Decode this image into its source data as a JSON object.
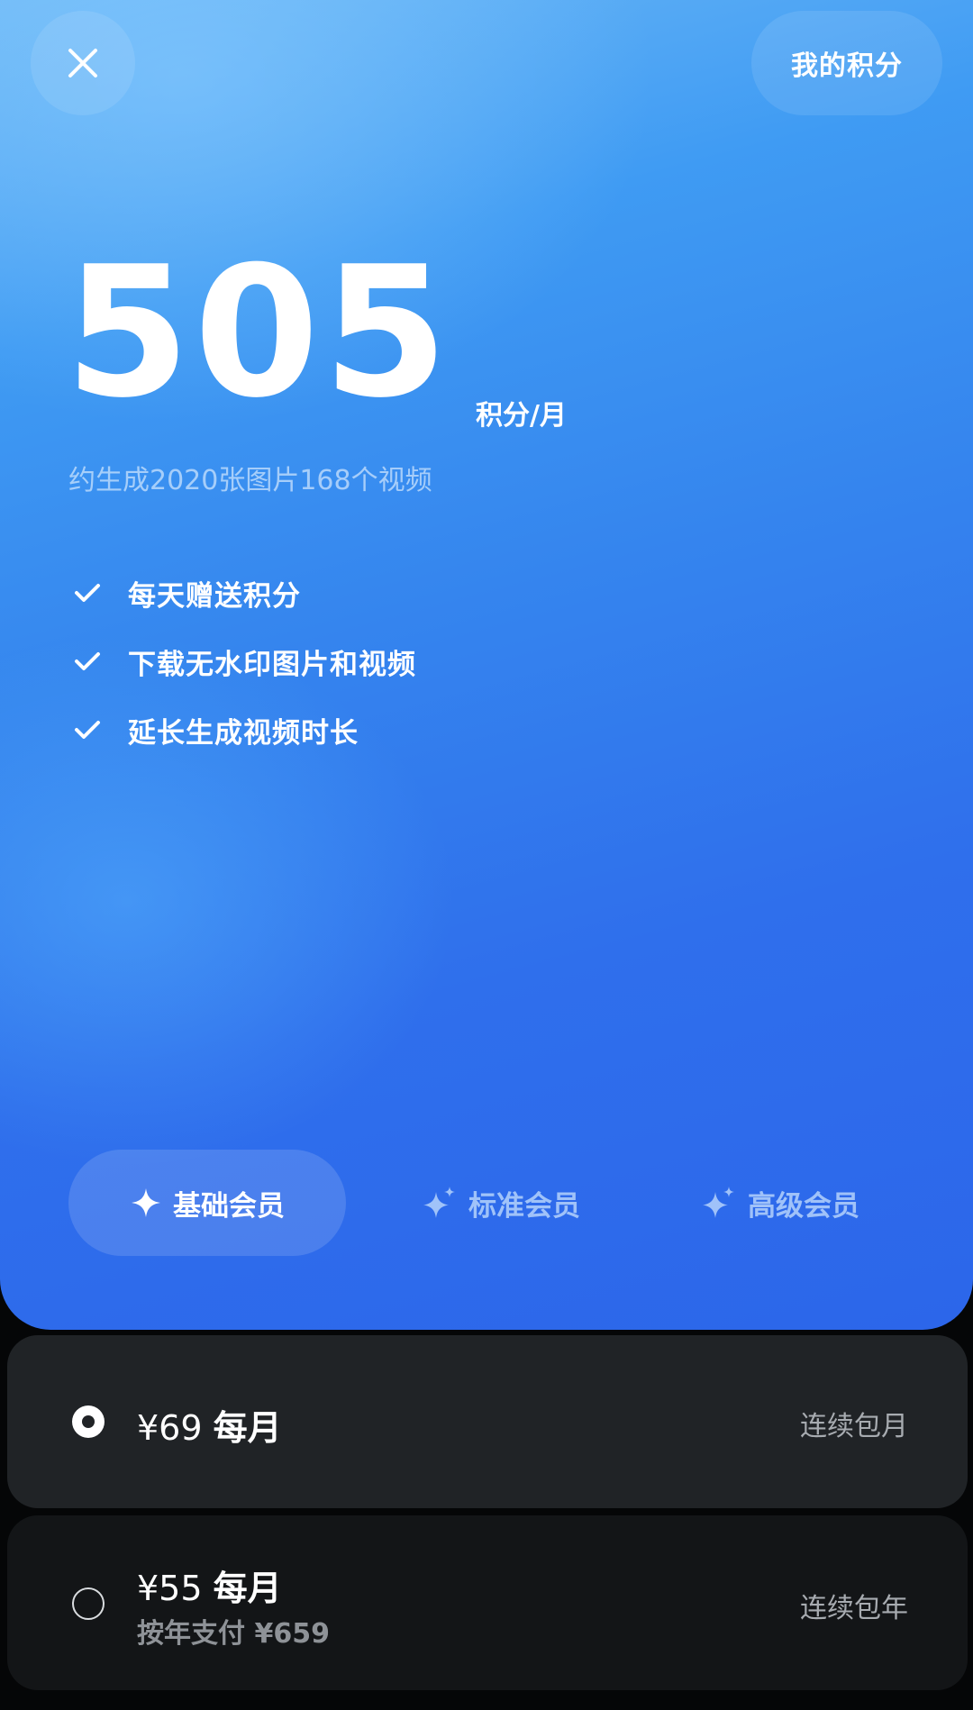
{
  "header": {
    "close_icon": "close-icon",
    "my_points_label": "我的积分"
  },
  "points": {
    "value": "505",
    "unit": "积分/月",
    "estimate": "约生成2020张图片168个视频"
  },
  "features": [
    {
      "icon": "check-icon",
      "label": "每天赠送积分"
    },
    {
      "icon": "check-icon",
      "label": "下载无水印图片和视频"
    },
    {
      "icon": "check-icon",
      "label": "延长生成视频时长"
    }
  ],
  "tiers": [
    {
      "icon": "sparkle-icon",
      "label": "基础会员",
      "selected": true
    },
    {
      "icon": "sparkle-icon",
      "label": "标准会员",
      "selected": false
    },
    {
      "icon": "sparkle-icon",
      "label": "高级会员",
      "selected": false
    }
  ],
  "plans": [
    {
      "price": "¥69",
      "period": "每月",
      "note": "",
      "type": "连续包月",
      "selected": true
    },
    {
      "price": "¥55",
      "period": "每月",
      "note": "按年支付 ¥659",
      "type": "连续包年",
      "selected": false
    }
  ],
  "colors": {
    "hero_top": "#6cb8f6",
    "hero_bottom": "#2c66ea",
    "card_selected": "#202326",
    "card_unselected": "#131517",
    "page_bg": "#050607"
  }
}
